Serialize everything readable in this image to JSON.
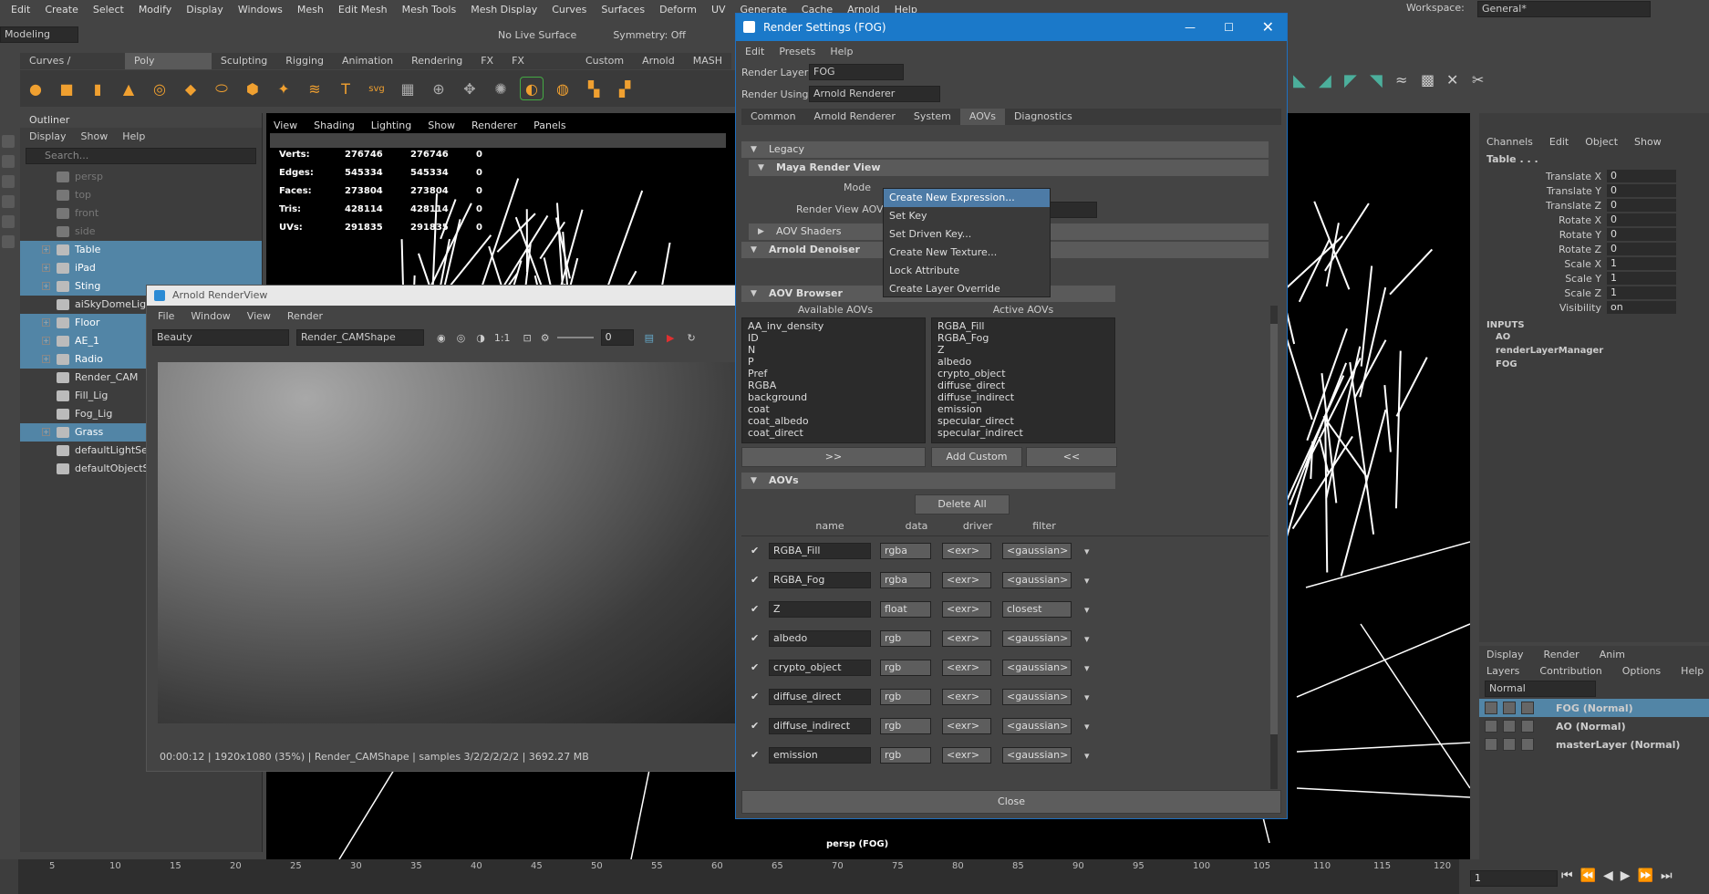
{
  "menubar": [
    "Edit",
    "Create",
    "Select",
    "Modify",
    "Display",
    "Windows",
    "Mesh",
    "Edit Mesh",
    "Mesh Tools",
    "Mesh Display",
    "Curves",
    "Surfaces",
    "Deform",
    "UV",
    "Generate",
    "Cache",
    "Arnold",
    "Help"
  ],
  "workspace": {
    "label": "Workspace:",
    "value": "General*"
  },
  "toolbar": {
    "mode": "Modeling",
    "live_surface": "No Live Surface",
    "symmetry": "Symmetry: Off"
  },
  "shelf_tabs": [
    "Curves / Surfaces",
    "Poly Modeling",
    "Sculpting",
    "Rigging",
    "Animation",
    "Rendering",
    "FX",
    "FX Caching",
    "Custom",
    "Arnold",
    "MASH"
  ],
  "outliner": {
    "title": "Outliner",
    "menus": [
      "Display",
      "Show",
      "Help"
    ],
    "search_placeholder": "Search...",
    "items": [
      {
        "label": "persp",
        "dim": true,
        "sel": false
      },
      {
        "label": "top",
        "dim": true,
        "sel": false
      },
      {
        "label": "front",
        "dim": true,
        "sel": false
      },
      {
        "label": "side",
        "dim": true,
        "sel": false
      },
      {
        "label": "Table",
        "dim": false,
        "sel": true
      },
      {
        "label": "iPad",
        "dim": false,
        "sel": true
      },
      {
        "label": "Sting",
        "dim": false,
        "sel": true
      },
      {
        "label": "aiSkyDomeLight",
        "dim": false,
        "sel": false
      },
      {
        "label": "Floor",
        "dim": false,
        "sel": true
      },
      {
        "label": "AE_1",
        "dim": false,
        "sel": true
      },
      {
        "label": "Radio",
        "dim": false,
        "sel": true
      },
      {
        "label": "Render_CAM",
        "dim": false,
        "sel": false
      },
      {
        "label": "Fill_Lig",
        "dim": false,
        "sel": false
      },
      {
        "label": "Fog_Lig",
        "dim": false,
        "sel": false
      },
      {
        "label": "Grass",
        "dim": false,
        "sel": true
      },
      {
        "label": "defaultLightSet",
        "dim": false,
        "sel": false
      },
      {
        "label": "defaultObjectSet",
        "dim": false,
        "sel": false
      }
    ]
  },
  "viewport": {
    "menus": [
      "View",
      "Shading",
      "Lighting",
      "Show",
      "Renderer",
      "Panels"
    ],
    "hud": [
      {
        "k": "Verts:",
        "a": "276746",
        "b": "276746",
        "c": "0"
      },
      {
        "k": "Edges:",
        "a": "545334",
        "b": "545334",
        "c": "0"
      },
      {
        "k": "Faces:",
        "a": "273804",
        "b": "273804",
        "c": "0"
      },
      {
        "k": "Tris:",
        "a": "428114",
        "b": "428114",
        "c": "0"
      },
      {
        "k": "UVs:",
        "a": "291835",
        "b": "291835",
        "c": "0"
      }
    ],
    "camera_label": "persp (FOG)"
  },
  "render_view": {
    "title": "Arnold RenderView",
    "menus": [
      "File",
      "Window",
      "View",
      "Render"
    ],
    "aov": "Beauty",
    "camera": "Render_CAMShape",
    "ratio": "1:1",
    "exposure": "0",
    "status": "00:00:12 | 1920x1080 (35%) | Render_CAMShape | samples 3/2/2/2/2/2 | 3692.27 MB"
  },
  "render_settings": {
    "title": "Render Settings (FOG)",
    "menus": [
      "Edit",
      "Presets",
      "Help"
    ],
    "render_layer_label": "Render Layer",
    "render_layer": "FOG",
    "render_using_label": "Render Using",
    "render_using": "Arnold Renderer",
    "tabs": [
      "Common",
      "Arnold Renderer",
      "System",
      "AOVs",
      "Diagnostics"
    ],
    "active_tab": "AOVs",
    "sections": {
      "legacy": "Legacy",
      "maya_rv": "Maya Render View",
      "mode_label": "Mode",
      "rv_aov_label": "Render View AOV",
      "aov_shaders": "AOV Shaders",
      "denoiser": "Arnold Denoiser",
      "browser": "AOV Browser",
      "aovs": "AOVs"
    },
    "available_label": "Available AOVs",
    "active_label": "Active AOVs",
    "available": [
      "AA_inv_density",
      "ID",
      "N",
      "P",
      "Pref",
      "RGBA",
      "background",
      "coat",
      "coat_albedo",
      "coat_direct"
    ],
    "active": [
      "RGBA_Fill",
      "RGBA_Fog",
      "Z",
      "albedo",
      "crypto_object",
      "diffuse_direct",
      "diffuse_indirect",
      "emission",
      "specular_direct",
      "specular_indirect"
    ],
    "btn_add": ">>",
    "btn_custom": "Add Custom",
    "btn_remove": "<<",
    "btn_delete_all": "Delete All",
    "cols": [
      "name",
      "data",
      "driver",
      "filter"
    ],
    "rows": [
      {
        "name": "RGBA_Fill",
        "data": "rgba",
        "driver": "<exr>",
        "filter": "<gaussian>"
      },
      {
        "name": "RGBA_Fog",
        "data": "rgba",
        "driver": "<exr>",
        "filter": "<gaussian>"
      },
      {
        "name": "Z",
        "data": "float",
        "driver": "<exr>",
        "filter": "closest"
      },
      {
        "name": "albedo",
        "data": "rgb",
        "driver": "<exr>",
        "filter": "<gaussian>"
      },
      {
        "name": "crypto_object",
        "data": "rgb",
        "driver": "<exr>",
        "filter": "<gaussian>"
      },
      {
        "name": "diffuse_direct",
        "data": "rgb",
        "driver": "<exr>",
        "filter": "<gaussian>"
      },
      {
        "name": "diffuse_indirect",
        "data": "rgb",
        "driver": "<exr>",
        "filter": "<gaussian>"
      },
      {
        "name": "emission",
        "data": "rgb",
        "driver": "<exr>",
        "filter": "<gaussian>"
      }
    ],
    "close": "Close"
  },
  "context_menu": [
    "Create New Expression...",
    "Set Key",
    "Set Driven Key...",
    "Create New Texture...",
    "Lock Attribute",
    "Create Layer Override"
  ],
  "channel_box": {
    "menus": [
      "Channels",
      "Edit",
      "Object",
      "Show"
    ],
    "object": "Table . . .",
    "attrs": [
      {
        "k": "Translate X",
        "v": "0"
      },
      {
        "k": "Translate Y",
        "v": "0"
      },
      {
        "k": "Translate Z",
        "v": "0"
      },
      {
        "k": "Rotate X",
        "v": "0"
      },
      {
        "k": "Rotate Y",
        "v": "0"
      },
      {
        "k": "Rotate Z",
        "v": "0"
      },
      {
        "k": "Scale X",
        "v": "1"
      },
      {
        "k": "Scale Y",
        "v": "1"
      },
      {
        "k": "Scale Z",
        "v": "1"
      },
      {
        "k": "Visibility",
        "v": "on"
      }
    ],
    "inputs_label": "INPUTS",
    "inputs": [
      "AO",
      "renderLayerManager",
      "FOG"
    ]
  },
  "layer_editor": {
    "tabs": [
      "Display",
      "Render",
      "Anim"
    ],
    "menus": [
      "Layers",
      "Contribution",
      "Options",
      "Help"
    ],
    "blend": "Normal",
    "layers": [
      {
        "name": "FOG (Normal)",
        "sel": true
      },
      {
        "name": "AO (Normal)",
        "sel": false
      },
      {
        "name": "masterLayer (Normal)",
        "sel": false
      }
    ]
  },
  "timeline": {
    "ticks": [
      "5",
      "10",
      "15",
      "20",
      "25",
      "30",
      "35",
      "40",
      "45",
      "50",
      "55",
      "60",
      "65",
      "70",
      "75",
      "80",
      "85",
      "90",
      "95",
      "100",
      "105",
      "110",
      "115",
      "120"
    ],
    "frame": "1"
  }
}
